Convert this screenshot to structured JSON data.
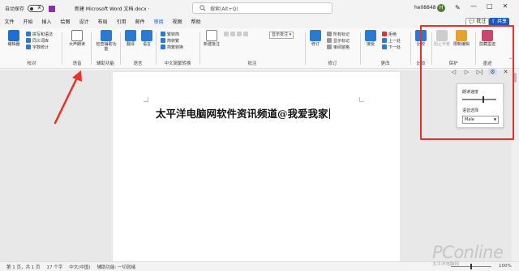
{
  "titlebar": {
    "autosave": "自动保存",
    "toggle": "关",
    "doc_title": "新建 Microsoft Word 文档.docx ·",
    "search_placeholder": "搜索(Alt+Q)",
    "user": "he08848",
    "avatar": "H",
    "min": "—",
    "max": "□",
    "close": "✕"
  },
  "menu": {
    "tabs": [
      "文件",
      "开始",
      "插入",
      "绘图",
      "设计",
      "布局",
      "引用",
      "邮件",
      "审阅",
      "视图",
      "帮助"
    ],
    "active": "审阅",
    "comment_btn": "批注",
    "share_btn": "共享"
  },
  "ribbon": {
    "proof": {
      "big": "编辑器",
      "items": [
        "拼写和语法",
        "同义词库",
        "字数统计"
      ],
      "label": "校对"
    },
    "speech": {
      "big": "大声朗读",
      "label": "语音"
    },
    "access": {
      "big": "检查辅助功能",
      "label": "辅助功能"
    },
    "lang": {
      "big": "翻译",
      "big2": "语言",
      "label": "语言"
    },
    "chinese": {
      "items": [
        "繁转简",
        "简转繁",
        "简繁转换"
      ],
      "label": "中文简繁转换"
    },
    "comments": {
      "big": "新建批注",
      "dropdown": "显示批注",
      "label": "批注"
    },
    "tracking": {
      "big": "修订",
      "items": [
        "所有标记",
        "显示标记",
        "审阅窗格"
      ],
      "label": "修订"
    },
    "changes": {
      "big": "接受",
      "items": [
        "拒绝",
        "上一处",
        "下一处"
      ],
      "label": "更改"
    },
    "compare": {
      "big": "比较",
      "label": "比较"
    },
    "protect": {
      "big": "阻止作者",
      "big2": "限制编辑",
      "label": "保护"
    },
    "ink": {
      "big": "隐藏墨迹",
      "label": "墨迹"
    }
  },
  "document": {
    "text": "太平洋电脑网软件资讯频道@我爱我家"
  },
  "read_aloud": {
    "speed_label": "朗读速度",
    "speed_value": 0.6,
    "voice_label": "语音选择",
    "voice": "Male"
  },
  "statusbar": {
    "page": "第 1 页，共 1 页",
    "words": "17 个字",
    "lang": "中文(中国)",
    "access": "辅助功能: 一切就绪",
    "zoom": "100%"
  },
  "watermark": {
    "brand": "PConline",
    "sub": "太平洋电脑网"
  },
  "colors": {
    "accent": "#185abd",
    "annotation": "#e8322b",
    "save_icon": "#8b2fa8"
  }
}
